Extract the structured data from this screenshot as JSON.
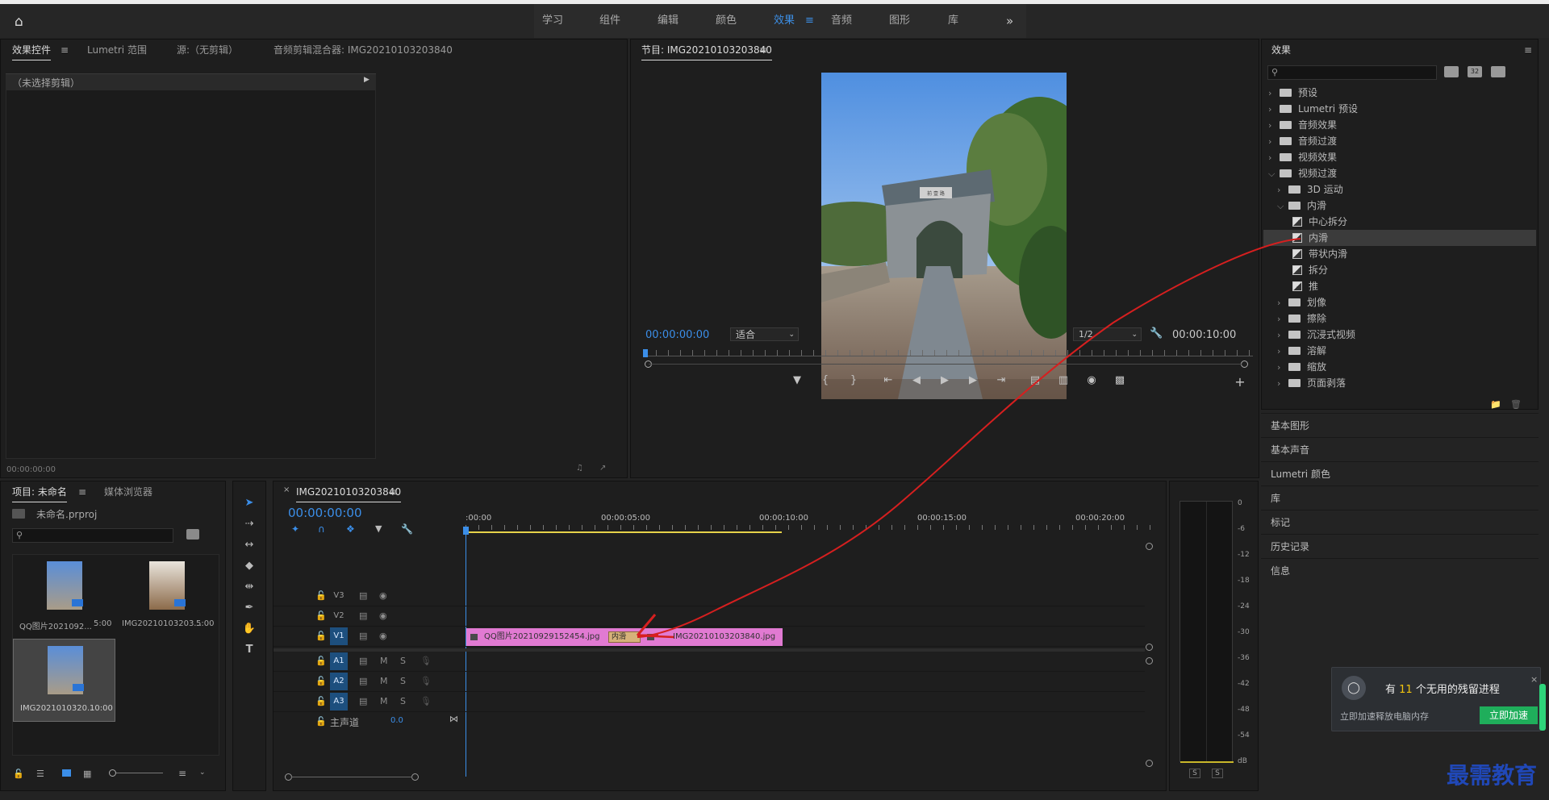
{
  "workspace": {
    "tabs": [
      "学习",
      "组件",
      "编辑",
      "颜色",
      "效果",
      "音频",
      "图形",
      "库"
    ],
    "active": "效果",
    "more": "»"
  },
  "effect_controls": {
    "tabs": [
      "效果控件",
      "Lumetri 范围",
      "源:（无剪辑）",
      "音频剪辑混合器: IMG20210103203840"
    ],
    "no_clip": "（未选择剪辑）",
    "timecode": "00:00:00:00"
  },
  "program": {
    "title": "节目: IMG20210103203840",
    "timecode": "00:00:00:00",
    "fit": "适合",
    "quality": "1/2",
    "duration": "00:00:10:00",
    "arch_sign": "前 壹 路"
  },
  "effects_panel": {
    "title": "效果",
    "search_placeholder": "",
    "badges": [
      "32"
    ],
    "items": [
      {
        "label": "预设",
        "level": 0,
        "open": false
      },
      {
        "label": "Lumetri 预设",
        "level": 0,
        "open": false
      },
      {
        "label": "音频效果",
        "level": 0,
        "open": false
      },
      {
        "label": "音频过渡",
        "level": 0,
        "open": false
      },
      {
        "label": "视频效果",
        "level": 0,
        "open": false
      },
      {
        "label": "视频过渡",
        "level": 0,
        "open": true
      },
      {
        "label": "3D 运动",
        "level": 1,
        "open": false
      },
      {
        "label": "内滑",
        "level": 1,
        "open": true
      },
      {
        "label": "中心拆分",
        "level": 2,
        "fx": true
      },
      {
        "label": "内滑",
        "level": 2,
        "fx": true,
        "selected": true
      },
      {
        "label": "带状内滑",
        "level": 2,
        "fx": true
      },
      {
        "label": "拆分",
        "level": 2,
        "fx": true
      },
      {
        "label": "推",
        "level": 2,
        "fx": true
      },
      {
        "label": "划像",
        "level": 1,
        "open": false
      },
      {
        "label": "擦除",
        "level": 1,
        "open": false
      },
      {
        "label": "沉浸式视频",
        "level": 1,
        "open": false
      },
      {
        "label": "溶解",
        "level": 1,
        "open": false
      },
      {
        "label": "缩放",
        "level": 1,
        "open": false
      },
      {
        "label": "页面剥落",
        "level": 1,
        "open": false
      }
    ],
    "sections": [
      "基本图形",
      "基本声音",
      "Lumetri 颜色",
      "库",
      "标记",
      "历史记录",
      "信息"
    ]
  },
  "project": {
    "tabs": [
      "项目: 未命名",
      "媒体浏览器"
    ],
    "file": "未命名.prproj",
    "items": [
      {
        "name": "QQ图片2021092...",
        "dur": "5:00"
      },
      {
        "name": "IMG20210103203...",
        "dur": "5:00"
      },
      {
        "name": "IMG2021010320...",
        "dur": "10:00"
      }
    ]
  },
  "timeline": {
    "title": "IMG20210103203840",
    "timecode": "00:00:00:00",
    "ruler": [
      ":00:00",
      "00:00:05:00",
      "00:00:10:00",
      "00:00:15:00",
      "00:00:20:00"
    ],
    "video_tracks": [
      "V3",
      "V2",
      "V1"
    ],
    "audio_tracks": [
      "A1",
      "A2",
      "A3"
    ],
    "master_label": "主声道",
    "master_value": "0.0",
    "clip1": "QQ图片20210929152454.jpg",
    "clip2": "IMG20210103203840.jpg",
    "transition": "内滑",
    "track_m": "M",
    "track_s": "S"
  },
  "meter": {
    "scale": [
      "0",
      "-6",
      "-12",
      "-18",
      "-24",
      "-30",
      "-36",
      "-42",
      "-48",
      "-54",
      "dB"
    ],
    "solo": [
      "S",
      "S"
    ]
  },
  "notification": {
    "pre": "有",
    "count": "11",
    "post": "个无用的残留进程",
    "sub": "立即加速释放电脑内存",
    "button": "立即加速"
  },
  "watermark": "最需教育"
}
